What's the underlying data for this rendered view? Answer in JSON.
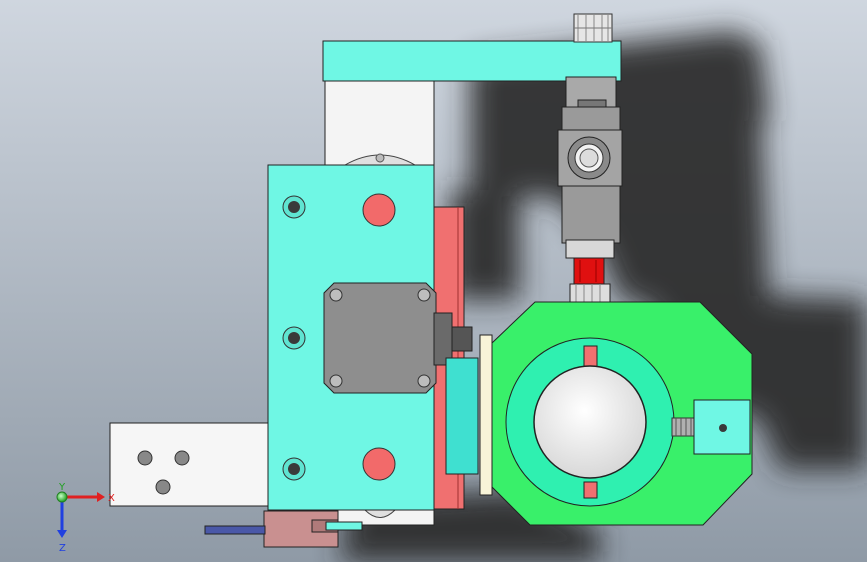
{
  "viewport": {
    "background_top": "#cfd6df",
    "background_bottom": "#8f9aa6"
  },
  "triad": {
    "x_label": "X",
    "y_label": "Y",
    "z_label": "Z",
    "x_color": "#e02020",
    "y_color": "#20b020",
    "z_color": "#2040e0"
  },
  "colors": {
    "cyan": "#6ff7e4",
    "cyan_dark": "#3fd9c4",
    "red_part": "#f07070",
    "red_dot": "#f26a6a",
    "green_body": "#39f06a",
    "green_ring": "#2ff0b0",
    "motor_gray": "#8e8e8e",
    "steel": "#9a9a9a",
    "white_part": "#f4f4f4",
    "pink_part": "#c99090",
    "shadow": "#2a2a2a"
  }
}
